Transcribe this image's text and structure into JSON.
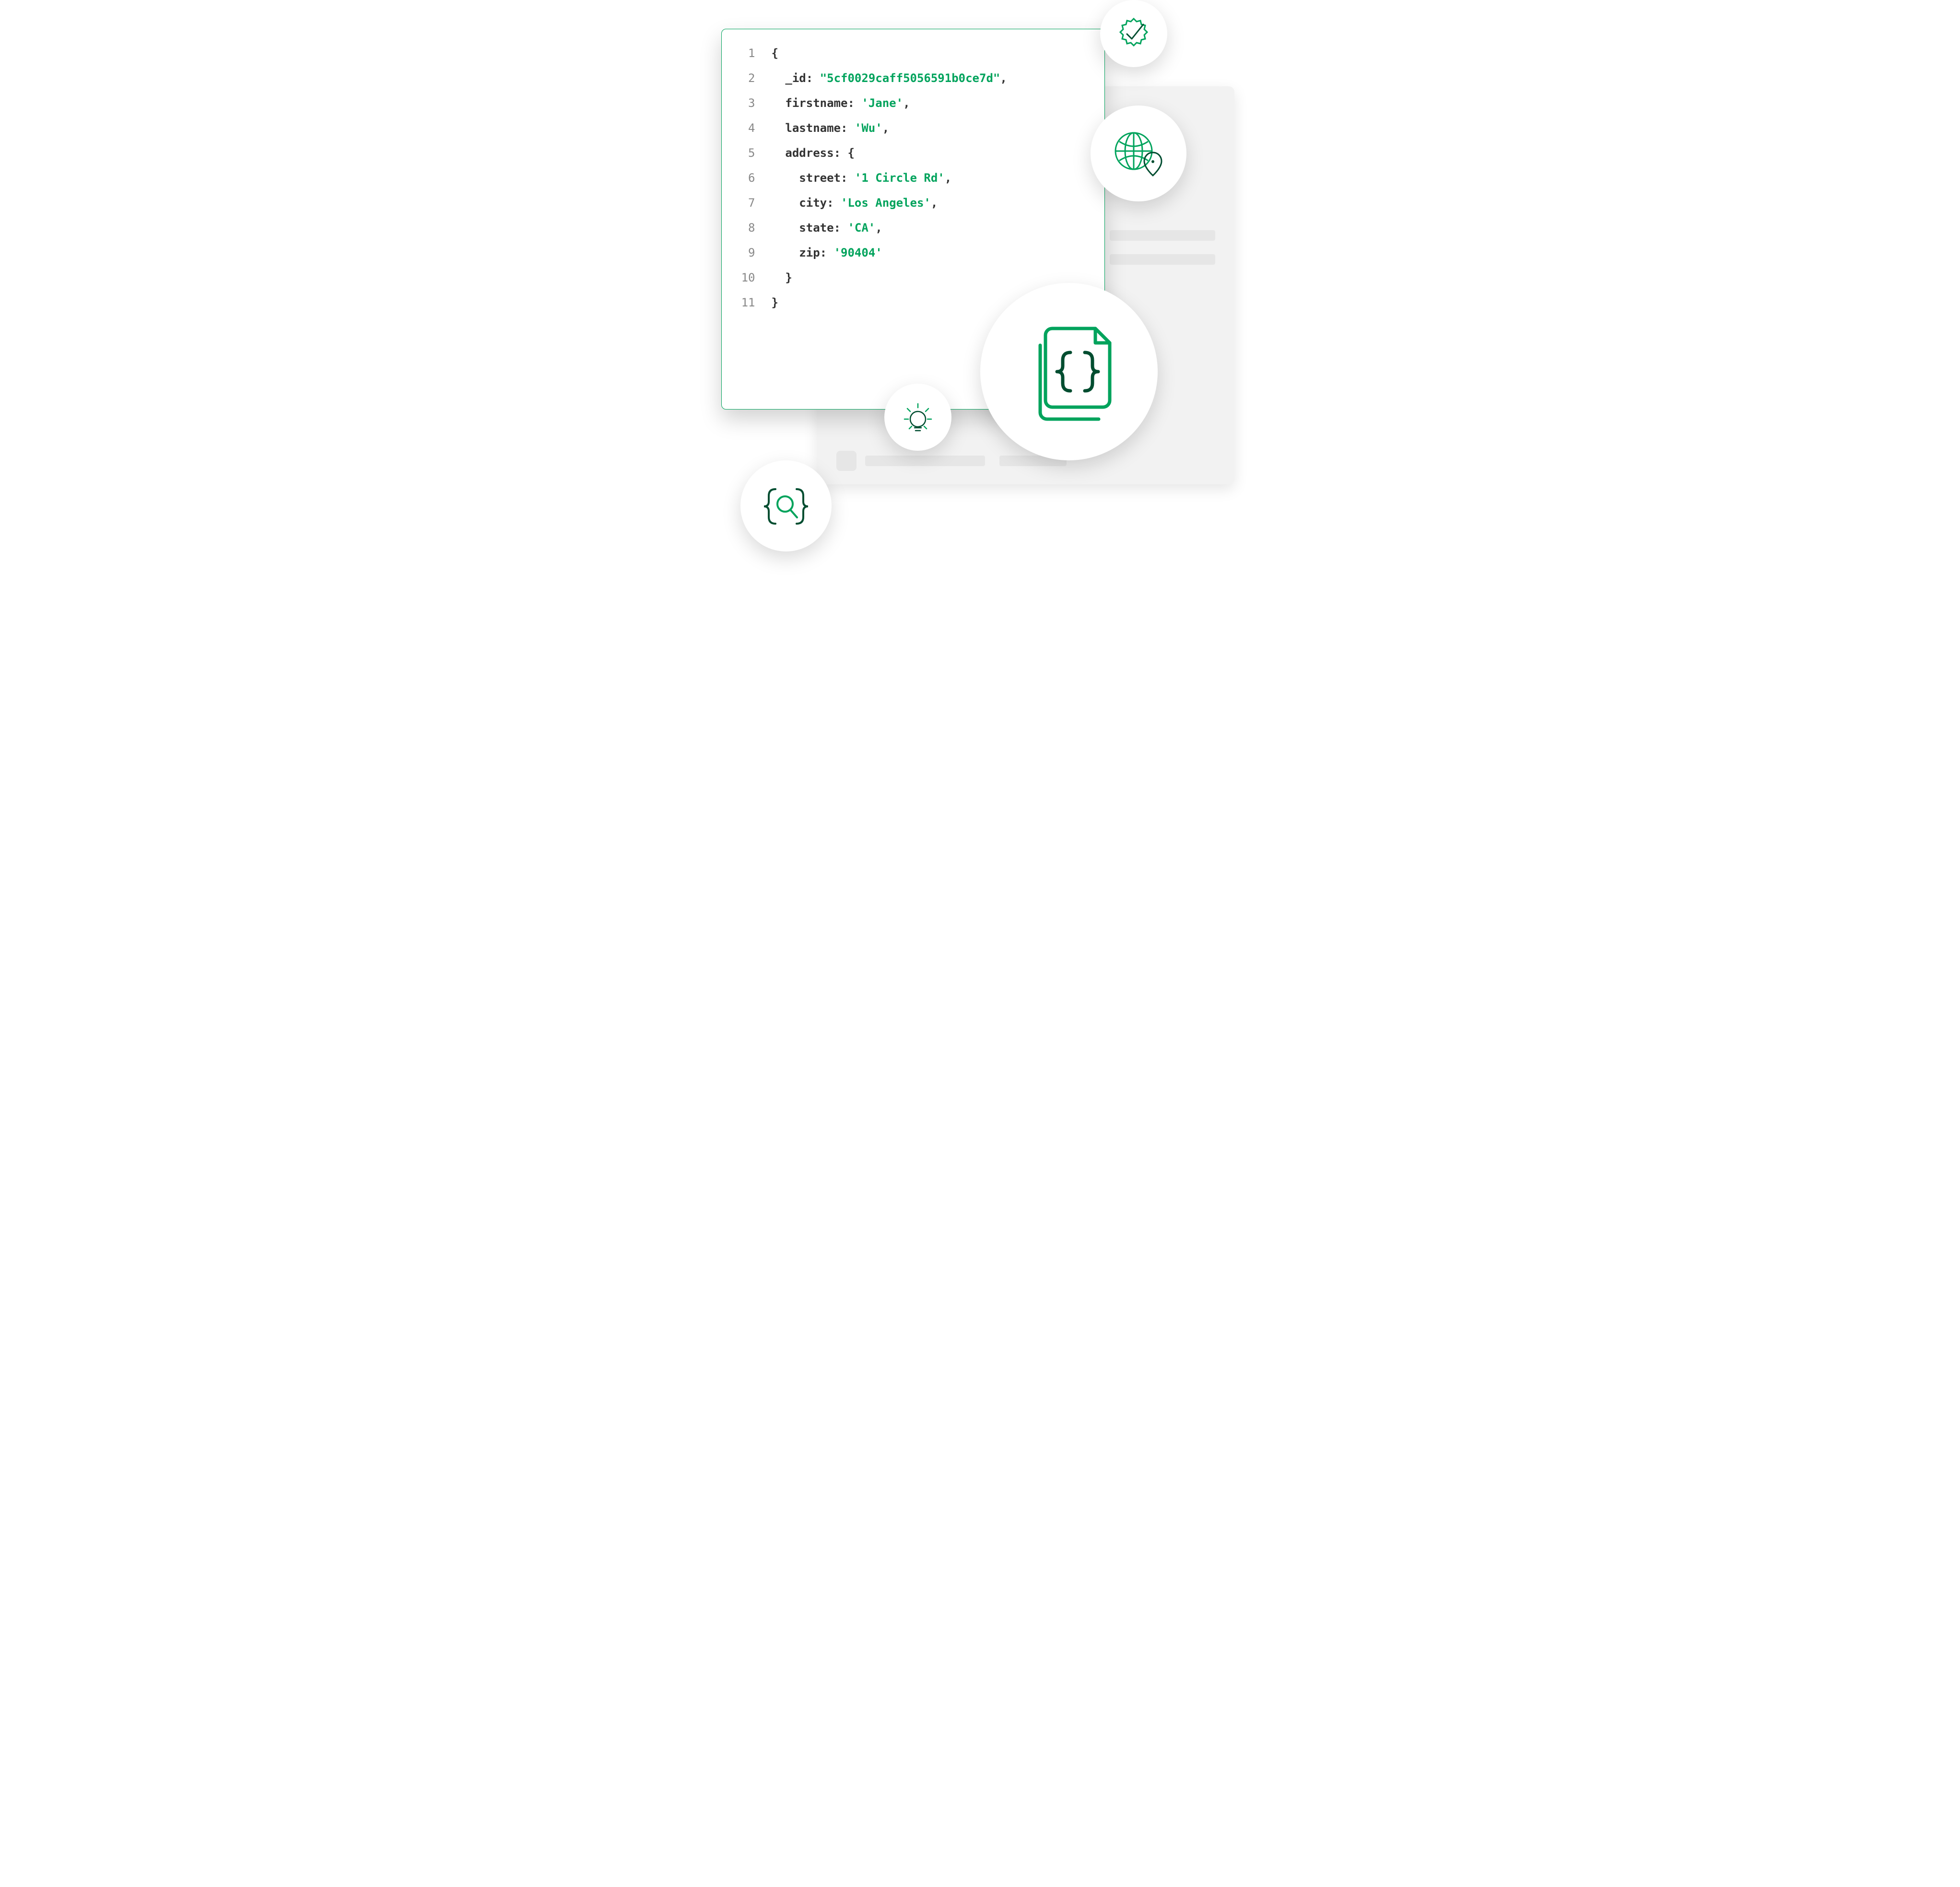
{
  "code": {
    "lines": [
      {
        "n": "1",
        "tokens": [
          {
            "t": "{",
            "c": "pun"
          }
        ]
      },
      {
        "n": "2",
        "tokens": [
          {
            "t": "  ",
            "c": "pun"
          },
          {
            "t": "_id",
            "c": "key"
          },
          {
            "t": ": ",
            "c": "pun"
          },
          {
            "t": "\"5cf0029caff5056591b0ce7d\"",
            "c": "str"
          },
          {
            "t": ",",
            "c": "pun"
          }
        ]
      },
      {
        "n": "3",
        "tokens": [
          {
            "t": "  ",
            "c": "pun"
          },
          {
            "t": "firstname",
            "c": "key"
          },
          {
            "t": ": ",
            "c": "pun"
          },
          {
            "t": "'Jane'",
            "c": "str"
          },
          {
            "t": ",",
            "c": "pun"
          }
        ]
      },
      {
        "n": "4",
        "tokens": [
          {
            "t": "  ",
            "c": "pun"
          },
          {
            "t": "lastname",
            "c": "key"
          },
          {
            "t": ": ",
            "c": "pun"
          },
          {
            "t": "'Wu'",
            "c": "str"
          },
          {
            "t": ",",
            "c": "pun"
          }
        ]
      },
      {
        "n": "5",
        "tokens": [
          {
            "t": "  ",
            "c": "pun"
          },
          {
            "t": "address",
            "c": "key"
          },
          {
            "t": ": {",
            "c": "pun"
          }
        ]
      },
      {
        "n": "6",
        "tokens": [
          {
            "t": "    ",
            "c": "pun"
          },
          {
            "t": "street",
            "c": "key"
          },
          {
            "t": ": ",
            "c": "pun"
          },
          {
            "t": "'1 Circle Rd'",
            "c": "str"
          },
          {
            "t": ",",
            "c": "pun"
          }
        ]
      },
      {
        "n": "7",
        "tokens": [
          {
            "t": "    ",
            "c": "pun"
          },
          {
            "t": "city",
            "c": "key"
          },
          {
            "t": ": ",
            "c": "pun"
          },
          {
            "t": "'Los Angeles'",
            "c": "str"
          },
          {
            "t": ",",
            "c": "pun"
          }
        ]
      },
      {
        "n": "8",
        "tokens": [
          {
            "t": "    ",
            "c": "pun"
          },
          {
            "t": "state",
            "c": "key"
          },
          {
            "t": ": ",
            "c": "pun"
          },
          {
            "t": "'CA'",
            "c": "str"
          },
          {
            "t": ",",
            "c": "pun"
          }
        ]
      },
      {
        "n": "9",
        "tokens": [
          {
            "t": "    ",
            "c": "pun"
          },
          {
            "t": "zip",
            "c": "key"
          },
          {
            "t": ": ",
            "c": "pun"
          },
          {
            "t": "'90404'",
            "c": "str"
          }
        ]
      },
      {
        "n": "10",
        "tokens": [
          {
            "t": "  }",
            "c": "pun"
          }
        ]
      },
      {
        "n": "11",
        "tokens": [
          {
            "t": "}",
            "c": "pun"
          }
        ]
      }
    ]
  },
  "icons": {
    "verify": "verified-checkmark-icon",
    "globe": "globe-location-icon",
    "docs": "json-documents-icon",
    "bulb": "lightbulb-icon",
    "search": "braces-search-icon"
  },
  "colors": {
    "green": "#00A35C",
    "darkgreen": "#004d30",
    "key": "#333333",
    "gutter": "#888888"
  }
}
